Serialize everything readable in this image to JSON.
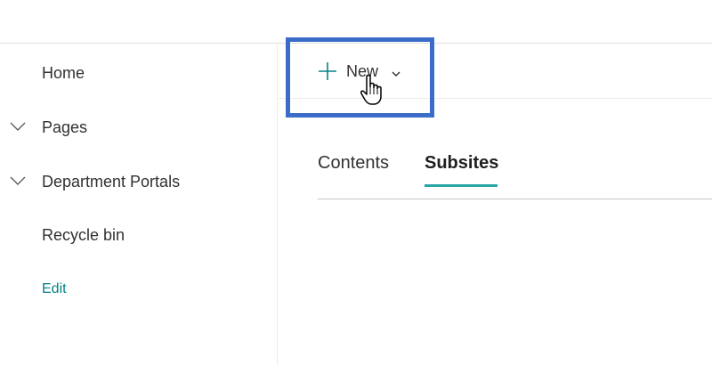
{
  "sidebar": {
    "items": [
      {
        "label": "Home",
        "expandable": false
      },
      {
        "label": "Pages",
        "expandable": true
      },
      {
        "label": "Department Portals",
        "expandable": true
      },
      {
        "label": "Recycle bin",
        "expandable": false
      }
    ],
    "edit_label": "Edit"
  },
  "command_bar": {
    "new_label": "New",
    "new_icon": "plus-icon",
    "dropdown_icon": "chevron-down-icon"
  },
  "tabs": [
    {
      "label": "Contents",
      "selected": false
    },
    {
      "label": "Subsites",
      "selected": true
    }
  ],
  "colors": {
    "accent": "#2aa5a5",
    "edit_link": "#038387",
    "highlight_box": "#3b6cc9"
  }
}
